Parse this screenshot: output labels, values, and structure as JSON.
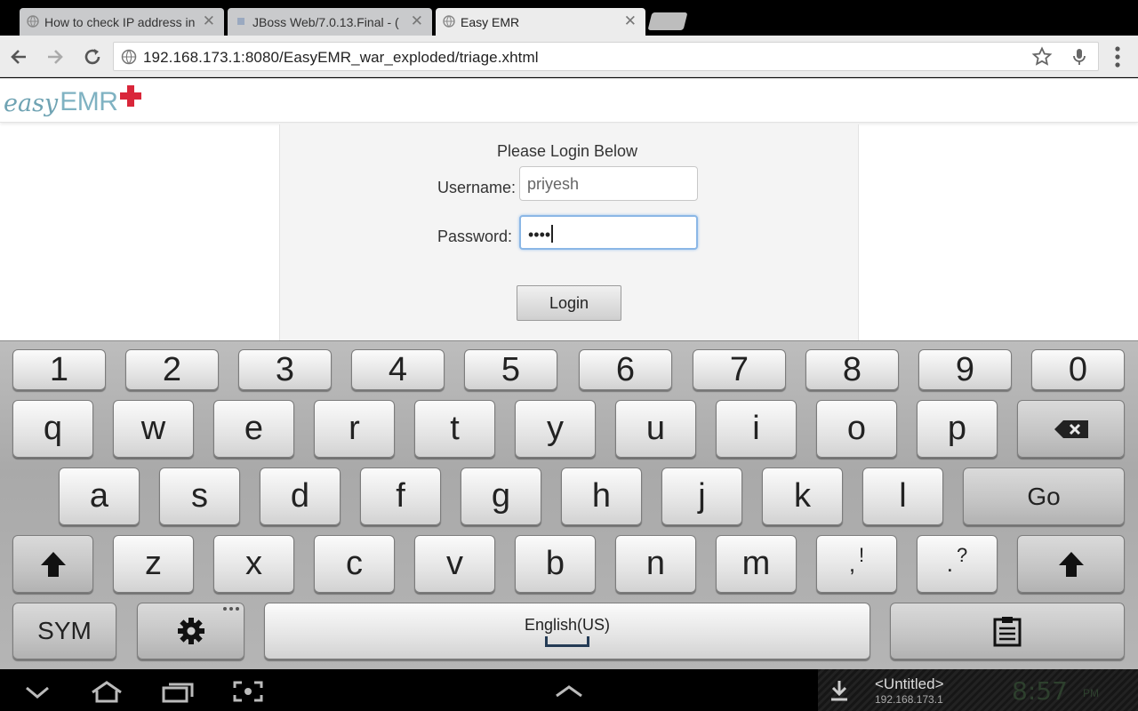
{
  "browser": {
    "tabs": [
      {
        "label": "How to check IP address in",
        "active": false
      },
      {
        "label": "JBoss Web/7.0.13.Final - (",
        "active": false
      },
      {
        "label": "Easy EMR",
        "active": true
      }
    ],
    "close_glyph": "✕",
    "url": "192.168.173.1:8080/EasyEMR_war_exploded/triage.xhtml",
    "icons": [
      "back-icon",
      "forward-icon",
      "reload-icon",
      "globe-icon",
      "star-icon",
      "mic-icon",
      "menu-icon"
    ]
  },
  "site": {
    "logo_easy": "easy",
    "logo_emr": "EMR"
  },
  "login": {
    "title": "Please Login Below",
    "username_label": "Username:",
    "username_value": "priyesh",
    "password_label": "Password:",
    "password_value": "••••",
    "button": "Login"
  },
  "keyboard": {
    "row_numbers": [
      "1",
      "2",
      "3",
      "4",
      "5",
      "6",
      "7",
      "8",
      "9",
      "0"
    ],
    "row_q": [
      "q",
      "w",
      "e",
      "r",
      "t",
      "y",
      "u",
      "i",
      "o",
      "p"
    ],
    "row_a": [
      "a",
      "s",
      "d",
      "f",
      "g",
      "h",
      "j",
      "k",
      "l"
    ],
    "row_z": [
      "z",
      "x",
      "c",
      "v",
      "b",
      "n",
      "m"
    ],
    "comma_key": {
      "main": ",",
      "alt": "!"
    },
    "period_key": {
      "main": ".",
      "alt": "?"
    },
    "go": "Go",
    "sym": "SYM",
    "space_label": "English(US)"
  },
  "notification": {
    "title": "<Untitled>",
    "subtitle": "192.168.173.1",
    "clock": "8:57",
    "ampm": "PM"
  },
  "colors": {
    "logo_text": "#6fa3b3",
    "logo_cross": "#d9263a",
    "focus_border": "#8bb7e6"
  }
}
